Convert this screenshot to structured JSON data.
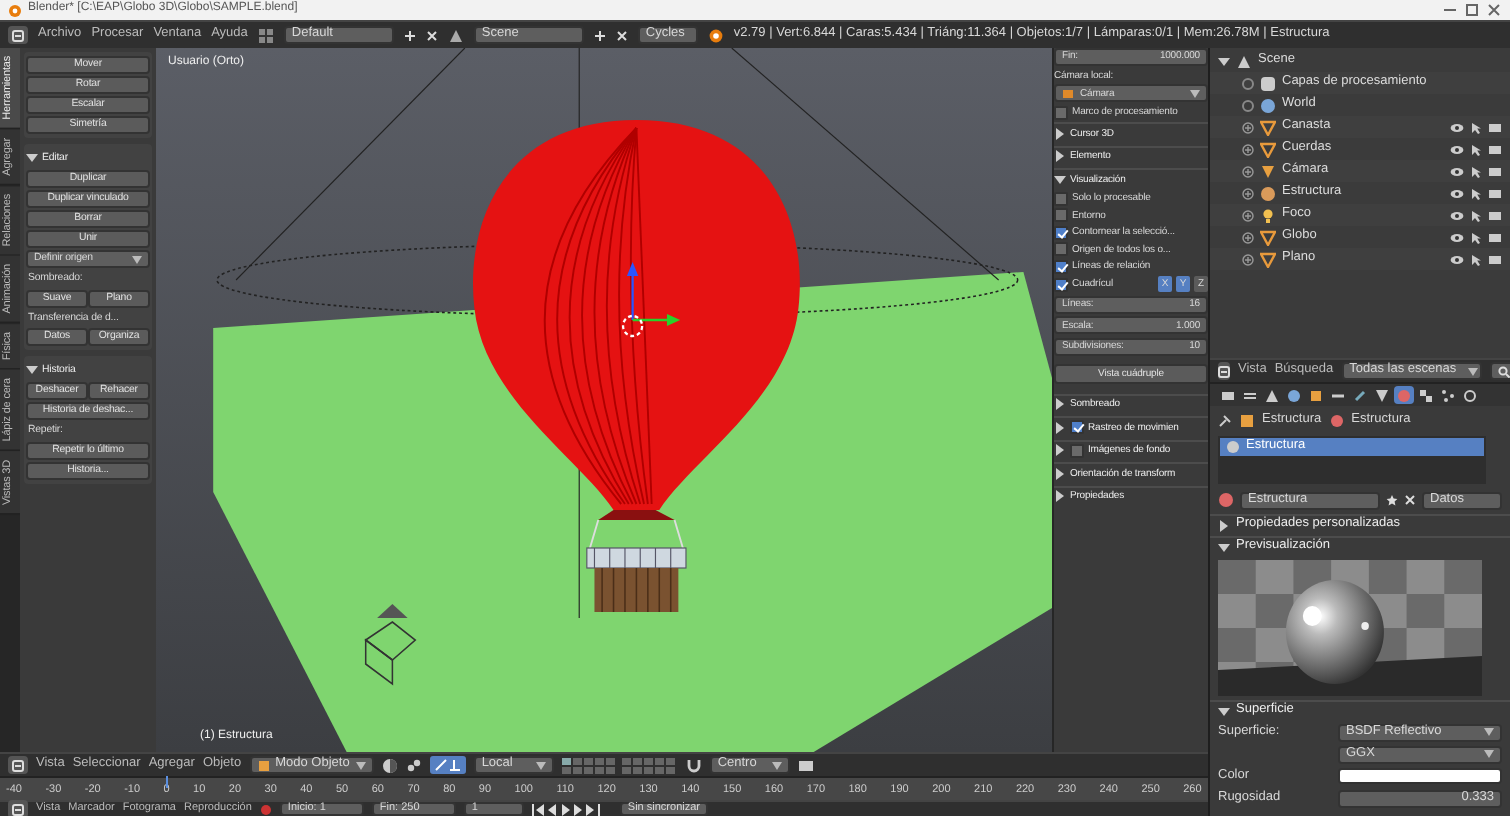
{
  "title_bar": {
    "title": "Blender* [C:\\EAP\\Globo 3D\\Globo\\SAMPLE.blend]"
  },
  "info_header": {
    "menus": [
      "Archivo",
      "Procesar",
      "Ventana",
      "Ayuda"
    ],
    "layout": "Default",
    "scene": "Scene",
    "engine": "Cycles",
    "stats": "v2.79 | Vert:6.844 | Caras:5.434 | Triáng:11.364 | Objetos:1/7 | Lámparas:0/1 | Mem:26.78M | Estructura"
  },
  "tool_shelf": {
    "tabs": [
      {
        "label": "Herramientas",
        "selected": true
      },
      {
        "label": "Agregar",
        "selected": false
      },
      {
        "label": "Relaciones",
        "selected": false
      },
      {
        "label": "Animación",
        "selected": false
      },
      {
        "label": "Física",
        "selected": false
      },
      {
        "label": "Lápiz de cera",
        "selected": false
      },
      {
        "label": "Vistas 3D",
        "selected": false
      }
    ],
    "sections": [
      {
        "rows": [
          {
            "kind": "buttons",
            "labels": [
              "Mover"
            ]
          },
          {
            "kind": "buttons",
            "labels": [
              "Rotar"
            ]
          },
          {
            "kind": "buttons",
            "labels": [
              "Escalar"
            ]
          },
          {
            "kind": "buttons",
            "labels": [
              "Simetría"
            ]
          }
        ]
      },
      {
        "title": "Editar",
        "expanded": true,
        "rows": [
          {
            "kind": "buttons",
            "labels": [
              "Duplicar"
            ]
          },
          {
            "kind": "buttons",
            "labels": [
              "Duplicar vinculado"
            ]
          },
          {
            "kind": "buttons",
            "labels": [
              "Borrar"
            ]
          },
          {
            "kind": "buttons",
            "labels": [
              "Unir"
            ]
          },
          {
            "kind": "dropdown",
            "text": "Definir origen"
          },
          {
            "kind": "label",
            "text": "Sombreado:"
          },
          {
            "kind": "buttons",
            "labels": [
              "Suave",
              "Plano"
            ]
          },
          {
            "kind": "label",
            "text": "Transferencia de d..."
          },
          {
            "kind": "buttons",
            "labels": [
              "Datos",
              "Organiza"
            ]
          }
        ]
      },
      {
        "title": "Historia",
        "expanded": true,
        "rows": [
          {
            "kind": "buttons",
            "labels": [
              "Deshacer",
              "Rehacer"
            ]
          },
          {
            "kind": "buttons",
            "labels": [
              "Historia de deshac..."
            ]
          },
          {
            "kind": "label",
            "text": "Repetir:"
          },
          {
            "kind": "buttons",
            "labels": [
              "Repetir lo último"
            ]
          },
          {
            "kind": "buttons",
            "labels": [
              "Historia..."
            ]
          }
        ]
      }
    ]
  },
  "viewport": {
    "view_name": "Usuario (Orto)",
    "object_name": "(1) Estructura"
  },
  "n_panel": {
    "rows": [
      {
        "kind": "field",
        "label": "Fin:",
        "value": "1000.000"
      },
      {
        "kind": "label",
        "text": "Cámara local:"
      },
      {
        "kind": "dropdown",
        "text": "Cámara"
      },
      {
        "kind": "check",
        "checked": false,
        "text": "Marco de procesamiento"
      },
      {
        "kind": "section",
        "expanded": false,
        "title": "Cursor 3D"
      },
      {
        "kind": "section",
        "expanded": false,
        "title": "Elemento"
      },
      {
        "kind": "section",
        "expanded": true,
        "title": "Visualización"
      },
      {
        "kind": "check",
        "checked": false,
        "text": "Solo lo procesable"
      },
      {
        "kind": "check",
        "checked": false,
        "text": "Entorno"
      },
      {
        "kind": "check",
        "checked": true,
        "text": "Contornear la selecció..."
      },
      {
        "kind": "check",
        "checked": false,
        "text": "Origen de todos los o..."
      },
      {
        "kind": "check",
        "checked": true,
        "text": "Líneas de relación"
      },
      {
        "kind": "grid",
        "checked": true,
        "text": "Cuadrícul",
        "axes": [
          {
            "label": "X",
            "selected": true
          },
          {
            "label": "Y",
            "selected": true
          },
          {
            "label": "Z",
            "selected": false
          }
        ]
      },
      {
        "kind": "field",
        "label": "Líneas:",
        "value": "16"
      },
      {
        "kind": "field",
        "label": "Escala:",
        "value": "1.000"
      },
      {
        "kind": "field",
        "label": "Subdivisiones:",
        "value": "10"
      },
      {
        "kind": "button",
        "text": "Vista cuádruple"
      },
      {
        "kind": "section",
        "expanded": false,
        "title": "Sombreado"
      },
      {
        "kind": "section",
        "expanded": false,
        "checked": true,
        "title": "Rastreo de movimien"
      },
      {
        "kind": "section",
        "expanded": false,
        "checked": false,
        "title": "Imágenes de fondo"
      },
      {
        "kind": "section",
        "expanded": false,
        "title": "Orientación de transform"
      },
      {
        "kind": "section",
        "expanded": false,
        "title": "Propiedades"
      }
    ]
  },
  "outliner": {
    "items": [
      {
        "label": "Scene",
        "kind": "scene",
        "expanded": true,
        "children": [
          {
            "label": "Capas de procesamiento",
            "kind": "render_layers"
          },
          {
            "label": "World",
            "kind": "world"
          },
          {
            "label": "Canasta",
            "kind": "mesh",
            "expanded": false
          },
          {
            "label": "Cuerdas",
            "kind": "mesh",
            "expanded": false
          },
          {
            "label": "Cámara",
            "kind": "camera",
            "expanded": false
          },
          {
            "label": "Estructura",
            "kind": "object",
            "expanded": false
          },
          {
            "label": "Foco",
            "kind": "lamp",
            "expanded": false
          },
          {
            "label": "Globo",
            "kind": "mesh",
            "expanded": false
          },
          {
            "label": "Plano",
            "kind": "mesh",
            "expanded": false
          }
        ]
      }
    ],
    "header": {
      "menus": [
        "Vista",
        "Búsqueda"
      ],
      "filter": "Todas las escenas"
    }
  },
  "properties": {
    "tabs": [
      {
        "kind": "render",
        "selected": false
      },
      {
        "kind": "layers",
        "selected": false
      },
      {
        "kind": "scene",
        "selected": false
      },
      {
        "kind": "world",
        "selected": false
      },
      {
        "kind": "object",
        "selected": false
      },
      {
        "kind": "constraints",
        "selected": false
      },
      {
        "kind": "modifiers",
        "selected": false
      },
      {
        "kind": "data",
        "selected": false
      },
      {
        "kind": "material",
        "selected": true
      },
      {
        "kind": "texture",
        "selected": false
      },
      {
        "kind": "particles",
        "selected": false
      },
      {
        "kind": "physics",
        "selected": false
      }
    ],
    "breadcrumb": [
      "Estructura",
      "Estructura"
    ],
    "slots": [
      {
        "label": "Estructura",
        "selected": true
      }
    ],
    "material": "Estructura",
    "link": "Datos",
    "sections": [
      {
        "title": "Propiedades personalizadas",
        "expanded": false
      },
      {
        "title": "Previsualización",
        "expanded": true
      }
    ],
    "surface": {
      "title": "Superficie",
      "expanded": true,
      "label": "Superficie:",
      "shader": "BSDF Reflectivo",
      "distribution": "GGX",
      "color_label": "Color",
      "color": "#ffffff",
      "roughness_label": "Rugosidad",
      "roughness": "0.333"
    }
  },
  "viewport_header": {
    "menus": [
      "Vista",
      "Seleccionar",
      "Agregar",
      "Objeto"
    ],
    "mode": "Modo Objeto",
    "orientation": "Local",
    "snap": "Centro"
  },
  "timeline": {
    "ticks": [
      {
        "label": "-40",
        "current": false
      },
      {
        "label": "-30",
        "current": false
      },
      {
        "label": "-20",
        "current": false
      },
      {
        "label": "-10",
        "current": false
      },
      {
        "label": "0",
        "current": true
      },
      {
        "label": "10",
        "current": false
      },
      {
        "label": "20",
        "current": false
      },
      {
        "label": "30",
        "current": false
      },
      {
        "label": "40",
        "current": false
      },
      {
        "label": "50",
        "current": false
      },
      {
        "label": "60",
        "current": false
      },
      {
        "label": "70",
        "current": false
      },
      {
        "label": "80",
        "current": false
      },
      {
        "label": "90",
        "current": false
      },
      {
        "label": "100",
        "current": false
      },
      {
        "label": "110",
        "current": false
      },
      {
        "label": "120",
        "current": false
      },
      {
        "label": "130",
        "current": false
      },
      {
        "label": "140",
        "current": false
      },
      {
        "label": "150",
        "current": false
      },
      {
        "label": "160",
        "current": false
      },
      {
        "label": "170",
        "current": false
      },
      {
        "label": "180",
        "current": false
      },
      {
        "label": "190",
        "current": false
      },
      {
        "label": "200",
        "current": false
      },
      {
        "label": "210",
        "current": false
      },
      {
        "label": "220",
        "current": false
      },
      {
        "label": "230",
        "current": false
      },
      {
        "label": "240",
        "current": false
      },
      {
        "label": "250",
        "current": false
      },
      {
        "label": "260",
        "current": false
      }
    ],
    "menus": [
      "Vista",
      "Marcador",
      "Fotograma",
      "Reproducción"
    ],
    "start": "Inicio: 1",
    "end": "Fin: 250",
    "frame": "1",
    "sync": "Sin sincronizar"
  }
}
